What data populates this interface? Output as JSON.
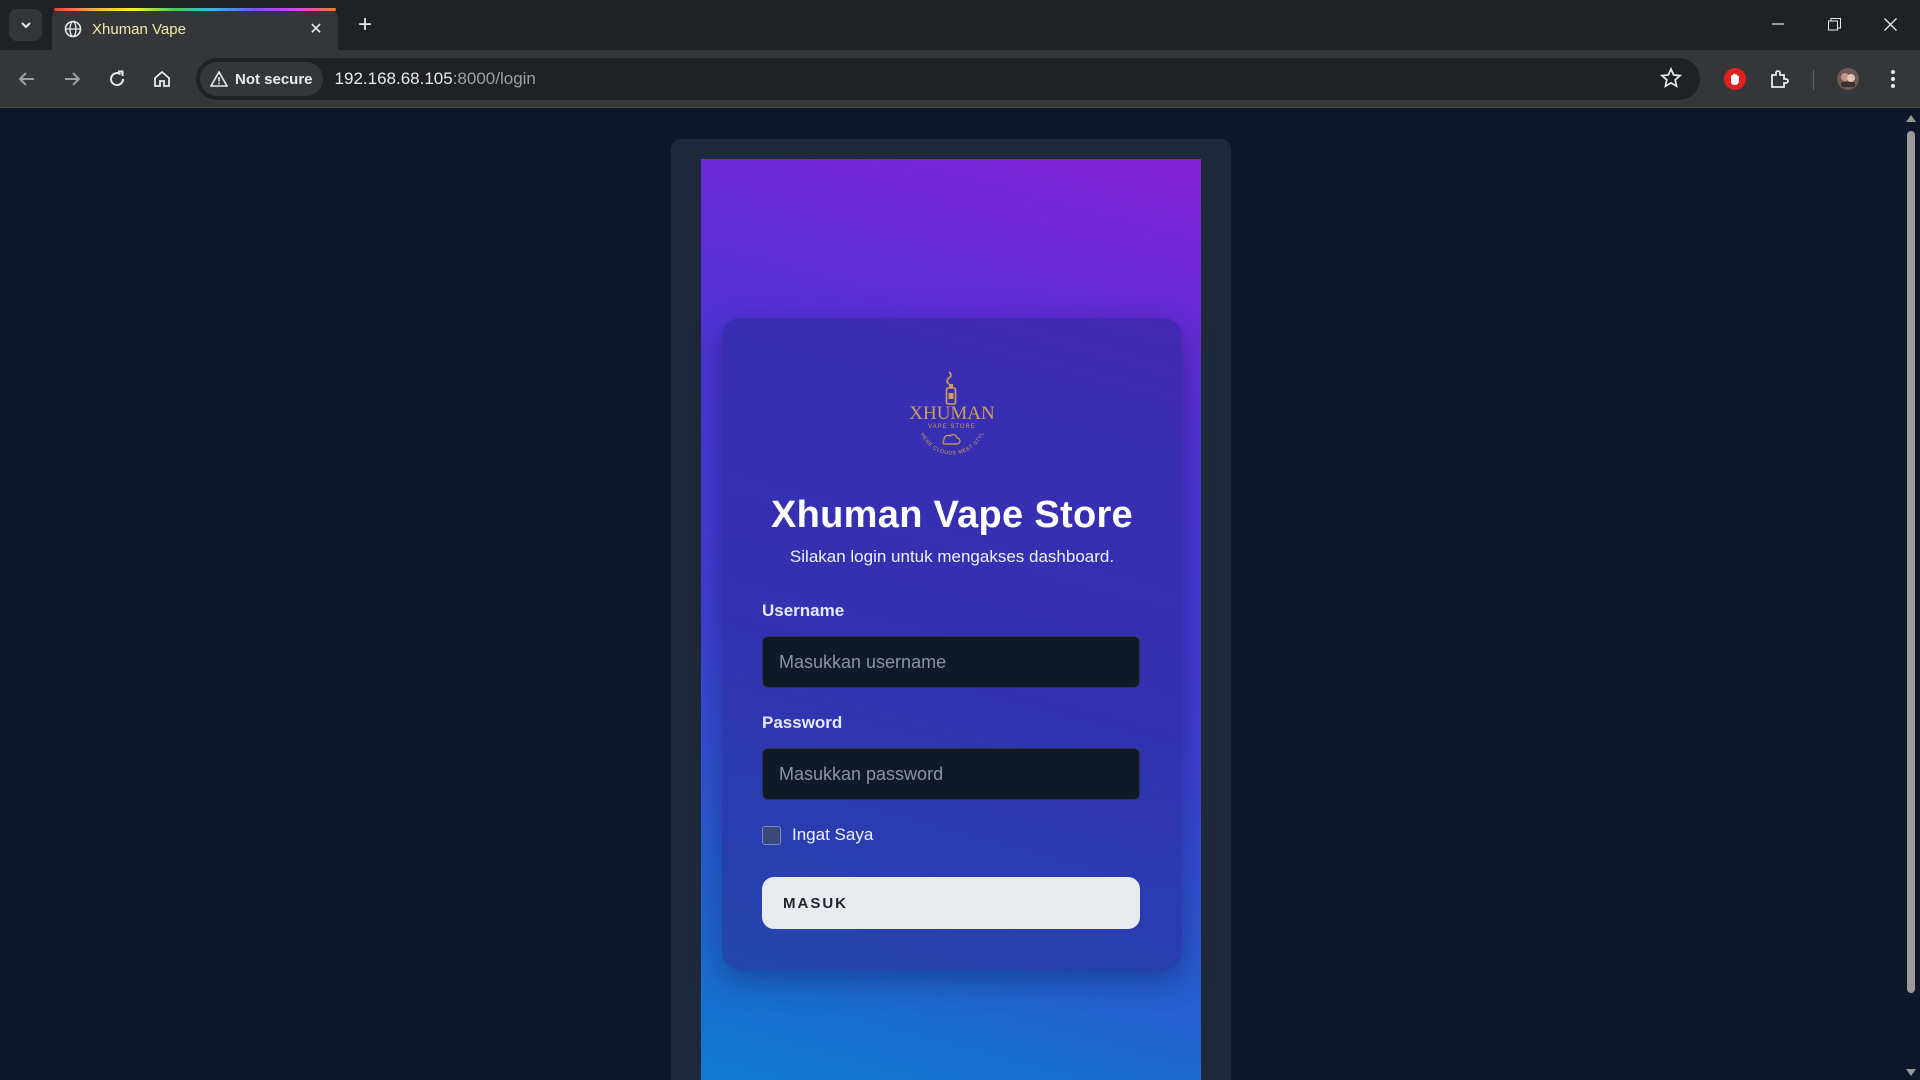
{
  "browser": {
    "tab_title": "Xhuman Vape",
    "security_label": "Not secure",
    "url_host": "192.168.68.105",
    "url_rest": ":8000/login"
  },
  "login": {
    "logo_text": "XHUMAN",
    "logo_subtext": "VAPE STORE",
    "logo_arc_text": "WHERE CLOUDS MEET STYLE",
    "title": "Xhuman Vape Store",
    "subtitle": "Silakan login untuk mengakses dashboard.",
    "username_label": "Username",
    "username_placeholder": "Masukkan username",
    "password_label": "Password",
    "password_placeholder": "Masukkan password",
    "remember_label": "Ingat Saya",
    "submit_label": "MASUK"
  },
  "colors": {
    "page_background": "#0f172a",
    "frame": "#1e293b",
    "gradient_top": "#8321d6",
    "gradient_bottom": "#0c7ed0",
    "logo_gold": "#c9a15c"
  }
}
